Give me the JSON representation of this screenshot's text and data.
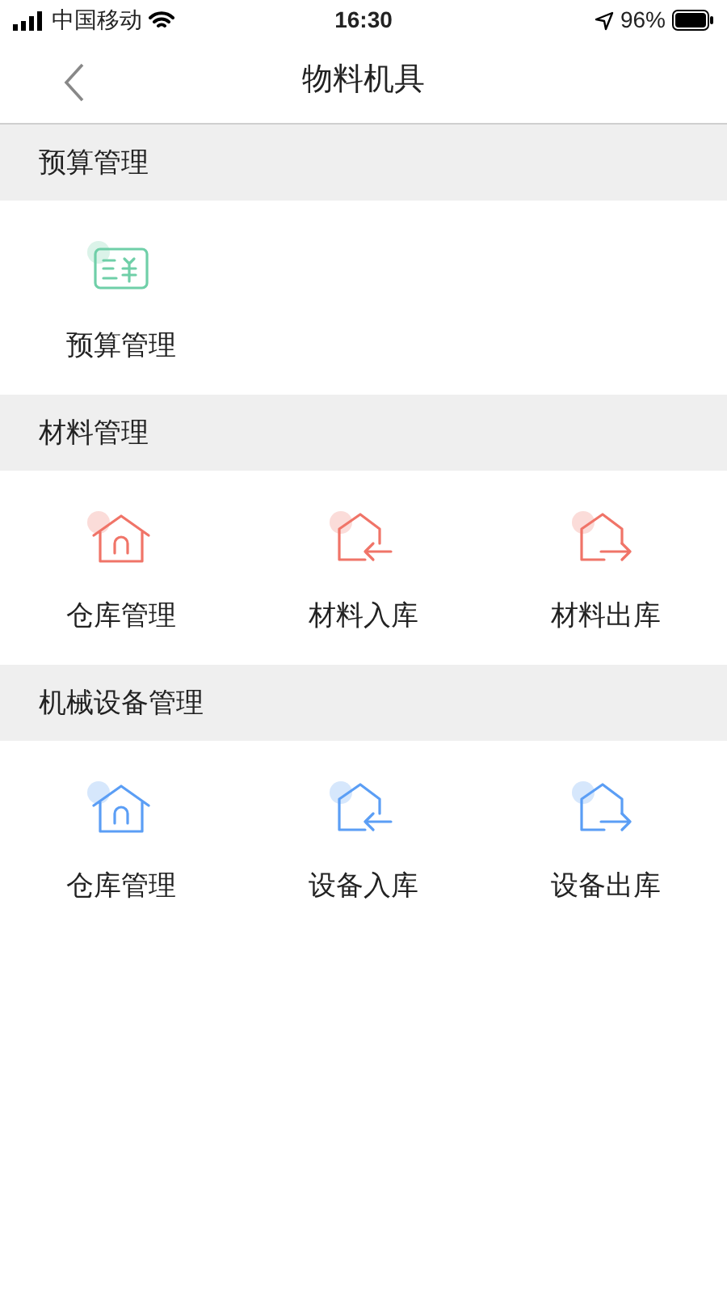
{
  "status_bar": {
    "carrier": "中国移动",
    "time": "16:30",
    "battery": "96%"
  },
  "nav": {
    "title": "物料机具"
  },
  "sections": [
    {
      "title": "预算管理",
      "color": "#6fcfa8",
      "items": [
        {
          "label": "预算管理",
          "kind": "budget"
        }
      ]
    },
    {
      "title": "材料管理",
      "color": "#f07468",
      "items": [
        {
          "label": "仓库管理",
          "kind": "warehouse"
        },
        {
          "label": "材料入库",
          "kind": "inbound"
        },
        {
          "label": "材料出库",
          "kind": "outbound"
        }
      ]
    },
    {
      "title": "机械设备管理",
      "color": "#5b9ef5",
      "items": [
        {
          "label": "仓库管理",
          "kind": "warehouse"
        },
        {
          "label": "设备入库",
          "kind": "inbound"
        },
        {
          "label": "设备出库",
          "kind": "outbound"
        }
      ]
    }
  ]
}
